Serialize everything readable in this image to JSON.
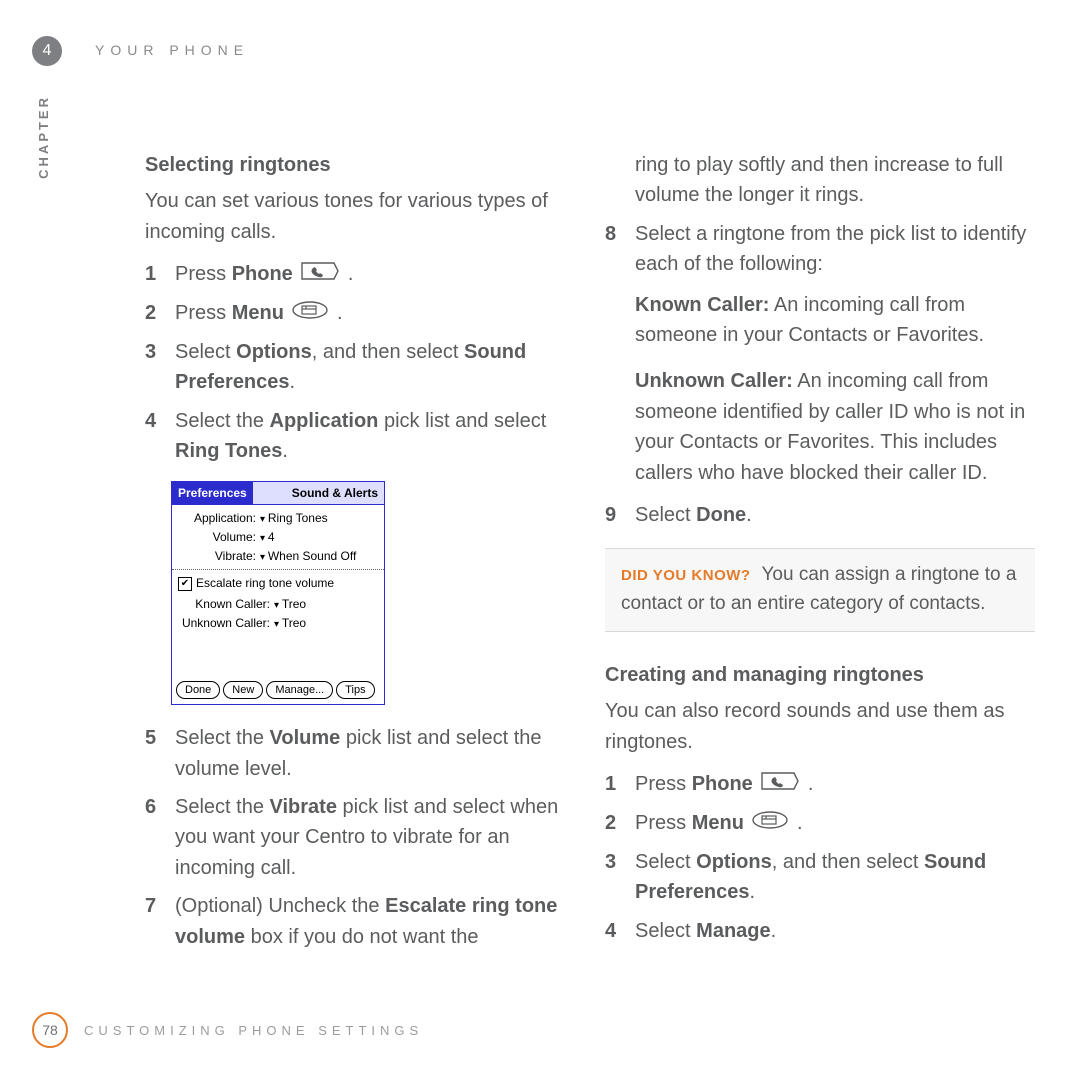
{
  "header": {
    "chapter_number": "4",
    "chapter_label": "CHAPTER",
    "running_head": "YOUR PHONE"
  },
  "left": {
    "section_title": "Selecting ringtones",
    "lead": "You can set various tones for various types of incoming calls.",
    "steps": {
      "s1_num": "1",
      "s1_pre": "Press ",
      "s1_bold": "Phone",
      "s1_post": " .",
      "s2_num": "2",
      "s2_pre": "Press ",
      "s2_bold": "Menu",
      "s2_post": " .",
      "s3_num": "3",
      "s3_a": "Select ",
      "s3_b": "Options",
      "s3_c": ", and then select ",
      "s3_d": "Sound Preferences",
      "s3_e": ".",
      "s4_num": "4",
      "s4_a": "Select the ",
      "s4_b": "Application",
      "s4_c": " pick list and select ",
      "s4_d": "Ring Tones",
      "s4_e": ".",
      "s5_num": "5",
      "s5_a": "Select the ",
      "s5_b": "Volume",
      "s5_c": " pick list and select the volume level.",
      "s6_num": "6",
      "s6_a": "Select the ",
      "s6_b": "Vibrate",
      "s6_c": " pick list and select when you want your Centro to vibrate for an incoming call.",
      "s7_num": "7",
      "s7_a": "(Optional)  Uncheck the ",
      "s7_b": "Escalate ring tone volume",
      "s7_c": " box if you do not want the"
    }
  },
  "phone_screen": {
    "title_tab": "Preferences",
    "title_right": "Sound & Alerts",
    "rows": {
      "app_label": "Application:",
      "app_value": "Ring Tones",
      "vol_label": "Volume:",
      "vol_value": "4",
      "vib_label": "Vibrate:",
      "vib_value": "When Sound Off"
    },
    "checkbox_label": "Escalate ring tone volume",
    "known_label": "Known Caller:",
    "known_value": "Treo",
    "unknown_label": "Unknown Caller:",
    "unknown_value": "Treo",
    "buttons": {
      "done": "Done",
      "new": "New",
      "manage": "Manage...",
      "tips": "Tips"
    }
  },
  "right": {
    "cont7": "ring to play softly and then increase to full volume the longer it rings.",
    "s8_num": "8",
    "s8_text": "Select a ringtone from the pick list to identify each of the following:",
    "known_title": "Known Caller:",
    "known_body": " An incoming call from someone in your Contacts or Favorites.",
    "unknown_title": "Unknown Caller:",
    "unknown_body": " An incoming call from someone identified by caller ID who is not in your Contacts or Favorites. This includes callers who have blocked their caller ID.",
    "s9_num": "9",
    "s9_a": "Select ",
    "s9_b": "Done",
    "s9_c": ".",
    "tip_label": "DID YOU KNOW?",
    "tip_body": "You can assign a ringtone to a contact or to an entire category of contacts.",
    "section2_title": "Creating and managing ringtones",
    "section2_lead": "You can also record sounds and use them as ringtones.",
    "b1_num": "1",
    "b1_pre": "Press ",
    "b1_bold": "Phone",
    "b1_post": " .",
    "b2_num": "2",
    "b2_pre": "Press ",
    "b2_bold": "Menu",
    "b2_post": " .",
    "b3_num": "3",
    "b3_a": "Select ",
    "b3_b": "Options",
    "b3_c": ", and then select ",
    "b3_d": "Sound Preferences",
    "b3_e": ".",
    "b4_num": "4",
    "b4_a": "Select ",
    "b4_b": "Manage",
    "b4_c": "."
  },
  "footer": {
    "page": "78",
    "title": "CUSTOMIZING PHONE SETTINGS"
  }
}
